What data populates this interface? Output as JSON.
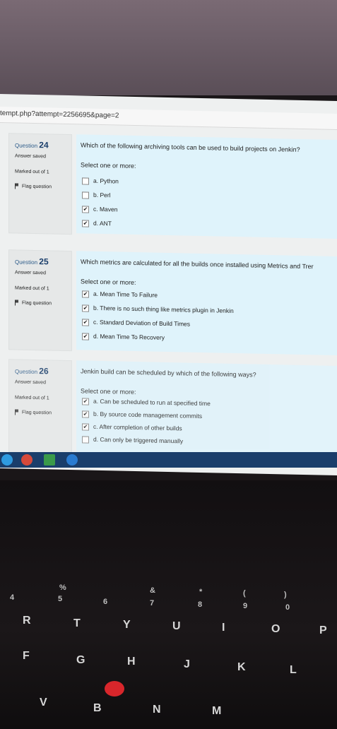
{
  "browser": {
    "url_fragment": "tempt.php?attempt=2256695&page=2"
  },
  "questions": [
    {
      "label": "Question",
      "number": "24",
      "state": "Answer saved",
      "marks": "Marked out of 1",
      "flag": "Flag question",
      "text": "Which of the following archiving tools can be used to build projects on Jenkin?",
      "prompt": "Select one or more:",
      "options": [
        {
          "text": "a. Python",
          "checked": false
        },
        {
          "text": "b. Perl",
          "checked": false
        },
        {
          "text": "c. Maven",
          "checked": true
        },
        {
          "text": "d. ANT",
          "checked": true
        }
      ]
    },
    {
      "label": "Question",
      "number": "25",
      "state": "Answer saved",
      "marks": "Marked out of 1",
      "flag": "Flag question",
      "text": "Which metrics are calculated for all the builds once installed using Metrics and Trer",
      "prompt": "Select one or more:",
      "options": [
        {
          "text": "a. Mean Time To Failure",
          "checked": true
        },
        {
          "text": "b. There is no such thing like metrics plugin in Jenkin",
          "checked": true
        },
        {
          "text": "c. Standard Deviation of Build Times",
          "checked": true
        },
        {
          "text": "d. Mean Time To Recovery",
          "checked": true
        }
      ]
    },
    {
      "label": "Question",
      "number": "26",
      "state": "Answer saved",
      "marks": "Marked out of 1",
      "flag": "Flag question",
      "text": "Jenkin build can be scheduled by which of the following ways?",
      "prompt": "Select one or more:",
      "options": [
        {
          "text": "a. Can be scheduled to run at specified time",
          "checked": true
        },
        {
          "text": "b. By source code management commits",
          "checked": true
        },
        {
          "text": "c. After completion of other builds",
          "checked": true
        },
        {
          "text": "d. Can only be triggered manually",
          "checked": false
        }
      ]
    }
  ],
  "keyboard": {
    "row_num": [
      "4",
      "5",
      "6",
      "7",
      "8",
      "9",
      "0"
    ],
    "row_sym": [
      "%",
      "&",
      "*",
      "(",
      ")"
    ],
    "row_top": [
      "R",
      "T",
      "Y",
      "U",
      "I",
      "O",
      "P"
    ],
    "row_mid": [
      "F",
      "G",
      "H",
      "J",
      "K",
      "L"
    ],
    "row_bot": [
      "V",
      "B",
      "N",
      "M"
    ]
  },
  "colors": {
    "question_number": "#1a3e6b",
    "content_bg": "#dff3fb",
    "info_bg": "#e6e8e8",
    "taskbar": "#1a3e6b"
  }
}
